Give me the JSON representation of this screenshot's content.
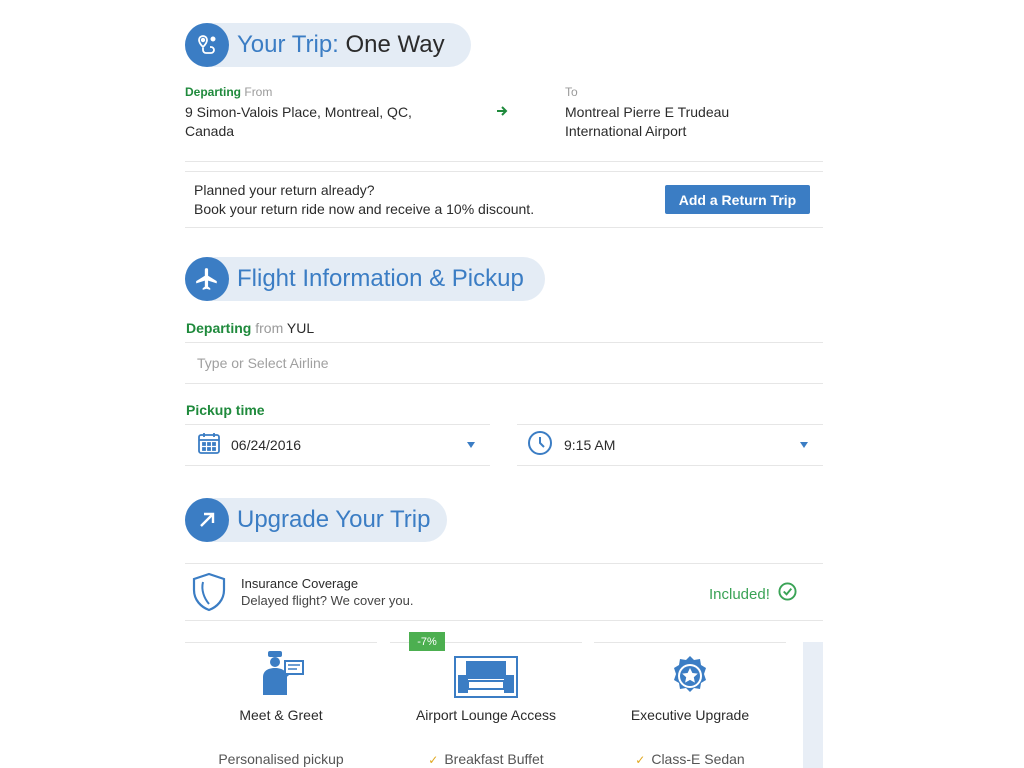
{
  "trip": {
    "title_prefix": "Your Trip:",
    "title_value": "One Way",
    "departing_label": "Departing",
    "from_label": "From",
    "from_address_line1": "9 Simon-Valois Place, Montreal, QC,",
    "from_address_line2": "Canada",
    "to_label": "To",
    "to_address_line1": "Montreal Pierre E Trudeau",
    "to_address_line2": "International Airport"
  },
  "return_promo": {
    "question": "Planned your return already?",
    "subtext": "Book your return ride now and receive a 10% discount.",
    "button_label": "Add a Return Trip"
  },
  "flight": {
    "title": "Flight Information & Pickup",
    "departing_label": "Departing",
    "from_text": "from",
    "airport_code": "YUL",
    "airline_placeholder": "Type or Select Airline",
    "pickup_label": "Pickup time",
    "date_value": "06/24/2016",
    "time_value": "9:15 AM"
  },
  "upgrade": {
    "title": "Upgrade Your Trip",
    "insurance_title": "Insurance Coverage",
    "insurance_subtitle": "Delayed flight? We cover you.",
    "insurance_status": "Included!",
    "cards": [
      {
        "title": "Meet & Greet",
        "feature": "Personalised pickup",
        "icon": "chauffeur-icon"
      },
      {
        "title": "Airport Lounge Access",
        "feature": "Breakfast Buffet",
        "badge": "-7%",
        "icon": "lounge-sofa-icon"
      },
      {
        "title": "Executive Upgrade",
        "feature": "Class-E Sedan",
        "icon": "star-seal-icon"
      }
    ]
  },
  "colors": {
    "accent": "#3b7dc4",
    "green": "#1f8a3c",
    "pill_bg": "#e4ecf5",
    "badge_green": "#4caf50",
    "check_yellow": "#e0a820"
  }
}
